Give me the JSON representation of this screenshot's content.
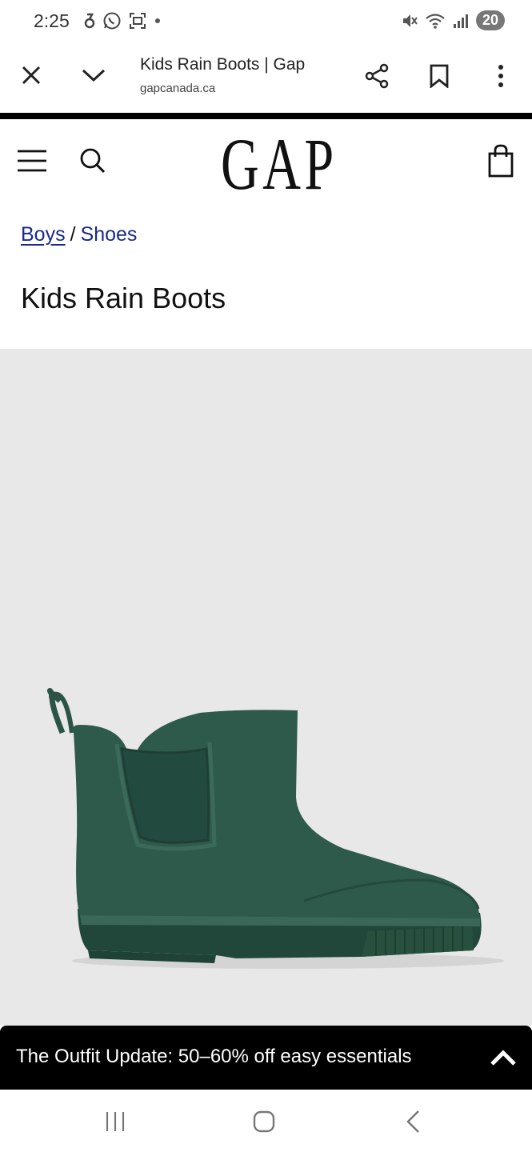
{
  "status_bar": {
    "time": "2:25",
    "battery": "20",
    "icons_left": [
      "notification-icon",
      "whatsapp-icon",
      "screenshot-icon",
      "dot-icon"
    ],
    "icons_right": [
      "mute-icon",
      "wifi-icon",
      "signal-icon"
    ]
  },
  "browser_tab": {
    "title": "Kids Rain Boots | Gap",
    "url": "gapcanada.ca",
    "icons": [
      "close-icon",
      "chevron-down-icon",
      "share-icon",
      "bookmark-icon",
      "more-icon"
    ]
  },
  "header": {
    "logo": "GAP",
    "icons": [
      "menu-icon",
      "search-icon",
      "shopping-bag-icon"
    ]
  },
  "breadcrumb": {
    "items": [
      "Boys",
      "Shoes"
    ],
    "separator": "/"
  },
  "page_title": "Kids Rain Boots",
  "product": {
    "image_bg": "#e8e8e8",
    "boot_color": "#2b5446"
  },
  "promo": {
    "text": "The Outfit Update: 50–60% off easy essentials",
    "icon": "chevron-up-icon"
  },
  "nav_bar": {
    "icons": [
      "recent-apps-icon",
      "home-icon",
      "back-icon"
    ]
  },
  "colors": {
    "link": "#1a2a8c",
    "promo_bg": "#000000"
  }
}
